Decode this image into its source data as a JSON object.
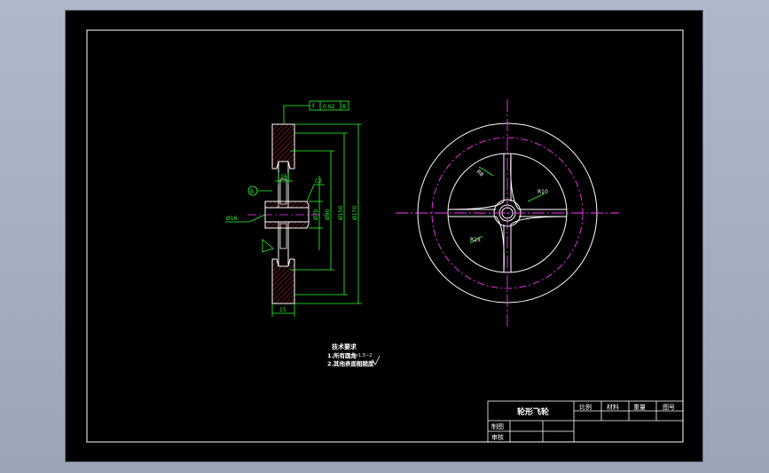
{
  "title_block": {
    "part_name": "轮形飞轮",
    "col_scale": "比例",
    "col_material": "材料",
    "col_weight": "重量",
    "col_drawing_no": "图号",
    "row_drawn": "制图",
    "row_checked": "审核"
  },
  "tech_requirements": {
    "heading": "技术要求",
    "line1": "1.所有圆角",
    "line1_note": "r1.5~2",
    "line2": "2.其他表面粗糙度"
  },
  "dimensions": {
    "tolerance_symbol": "f",
    "tolerance_value": "0.02",
    "tolerance_datum": "B",
    "datum_label": "B",
    "bore": "Ø16",
    "hub_width": "16",
    "chamfer": "C2",
    "d1": "Ø70",
    "d2": "Ø90",
    "d3": "Ø150",
    "d4": "Ø170",
    "rim_width": "15",
    "spoke_width": "R8",
    "spoke_radius": "R15",
    "hub_r": "R10"
  },
  "colors": {
    "sheet": "#000000",
    "lines": "#ffffff",
    "dimensions": "#2bff2b",
    "centerlines": "#ff33ff"
  }
}
